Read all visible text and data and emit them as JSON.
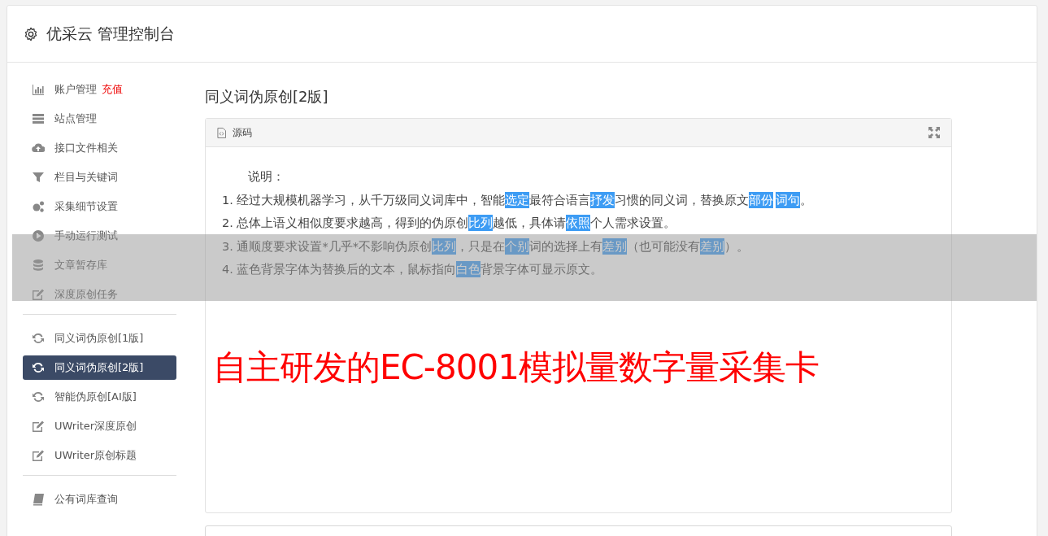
{
  "header": {
    "title": "优采云 管理控制台"
  },
  "sidebar": {
    "groups": [
      {
        "items": [
          {
            "label": "账户管理",
            "badge": "充值",
            "selected": false
          },
          {
            "label": "站点管理",
            "selected": false
          },
          {
            "label": "接口文件相关",
            "selected": false
          },
          {
            "label": "栏目与关键词",
            "selected": false
          },
          {
            "label": "采集细节设置",
            "selected": false
          },
          {
            "label": "手动运行测试",
            "selected": false
          },
          {
            "label": "文章暂存库",
            "selected": false
          },
          {
            "label": "深度原创任务",
            "selected": false
          }
        ]
      },
      {
        "items": [
          {
            "label": "同义词伪原创[1版]",
            "selected": false
          },
          {
            "label": "同义词伪原创[2版]",
            "selected": true
          },
          {
            "label": "智能伪原创[AI版]",
            "selected": false
          },
          {
            "label": "UWriter深度原创",
            "selected": false
          },
          {
            "label": "UWriter原创标题",
            "selected": false
          }
        ]
      },
      {
        "items": [
          {
            "label": "公有词库查询",
            "selected": false
          }
        ]
      }
    ]
  },
  "page": {
    "title": "同义词伪原创[2版]"
  },
  "panel": {
    "tab": "源码",
    "intro": "说明：",
    "lines": [
      [
        {
          "text": "1. 经过大规模机器学习，从千万级同义词库中，智能",
          "highlight": false
        },
        {
          "text": "选定",
          "highlight": true
        },
        {
          "text": "最符合语言",
          "highlight": false
        },
        {
          "text": "抒发",
          "highlight": true
        },
        {
          "text": "习惯的同义词，替换原文",
          "highlight": false
        },
        {
          "text": "部份",
          "highlight": true
        },
        {
          "text": "词句",
          "highlight": true
        },
        {
          "text": "。",
          "highlight": false
        }
      ],
      [
        {
          "text": "2. 总体上语义相似度要求越高，得到的伪原创",
          "highlight": false
        },
        {
          "text": "比列",
          "highlight": true
        },
        {
          "text": "越低，具体请",
          "highlight": false
        },
        {
          "text": "依照",
          "highlight": true
        },
        {
          "text": "个人需求设置。",
          "highlight": false
        }
      ],
      [
        {
          "text": "3. 通顺度要求设置*几乎*不影响伪原创",
          "highlight": false
        },
        {
          "text": "比列",
          "highlight": true
        },
        {
          "text": "，只是在",
          "highlight": false
        },
        {
          "text": "个别",
          "highlight": true
        },
        {
          "text": "词的选择上有",
          "highlight": false
        },
        {
          "text": "差别",
          "highlight": true
        },
        {
          "text": "（也可能没有",
          "highlight": false
        },
        {
          "text": "差别",
          "highlight": true
        },
        {
          "text": "）。",
          "highlight": false
        }
      ],
      [
        {
          "text": "4. 蓝色背景字体为替换后的文本，鼠标指向",
          "highlight": false
        },
        {
          "text": "白色",
          "highlight": true
        },
        {
          "text": "背景字体可显示原文。",
          "highlight": false
        }
      ]
    ]
  },
  "overlay": {
    "band": true,
    "caption": "自主研发的EC-8001模拟量数字量采集卡"
  }
}
